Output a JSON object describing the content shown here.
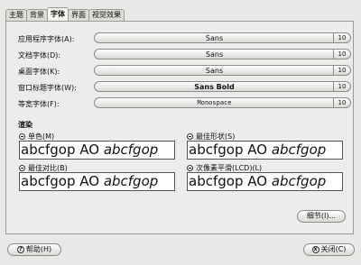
{
  "tabs": [
    "主题",
    "背景",
    "字体",
    "界面",
    "视觉效果"
  ],
  "active_tab": 2,
  "fonts": [
    {
      "label": "应用程序字体(A):",
      "name": "Sans",
      "size": "10"
    },
    {
      "label": "文档字体(D):",
      "name": "Sans",
      "size": "10"
    },
    {
      "label": "桌面字体(K):",
      "name": "Sans",
      "size": "10"
    },
    {
      "label": "窗口标题字体(W):",
      "name": "Sans Bold",
      "size": "10"
    },
    {
      "label": "等宽字体(F):",
      "name": "Monospace",
      "size": "10"
    }
  ],
  "rendering": {
    "title": "渲染",
    "options": [
      {
        "label": "单色(M)",
        "preview_regular": "abcfgop AO ",
        "preview_italic": "abcfgop"
      },
      {
        "label": "最佳形状(S)",
        "preview_regular": "abcfgop AO ",
        "preview_italic": "abcfgop"
      },
      {
        "label": "最佳对比(B)",
        "preview_regular": "abcfgop AO ",
        "preview_italic": "abcfgop"
      },
      {
        "label": "次像素平滑(LCD)(L)",
        "preview_regular": "abcfgop AO ",
        "preview_italic": "abcfgop"
      }
    ]
  },
  "buttons": {
    "details": "细节(I)...",
    "help": "帮助(H)",
    "close": "关闭(C)"
  },
  "icons": {
    "help": "?",
    "close": "x"
  }
}
